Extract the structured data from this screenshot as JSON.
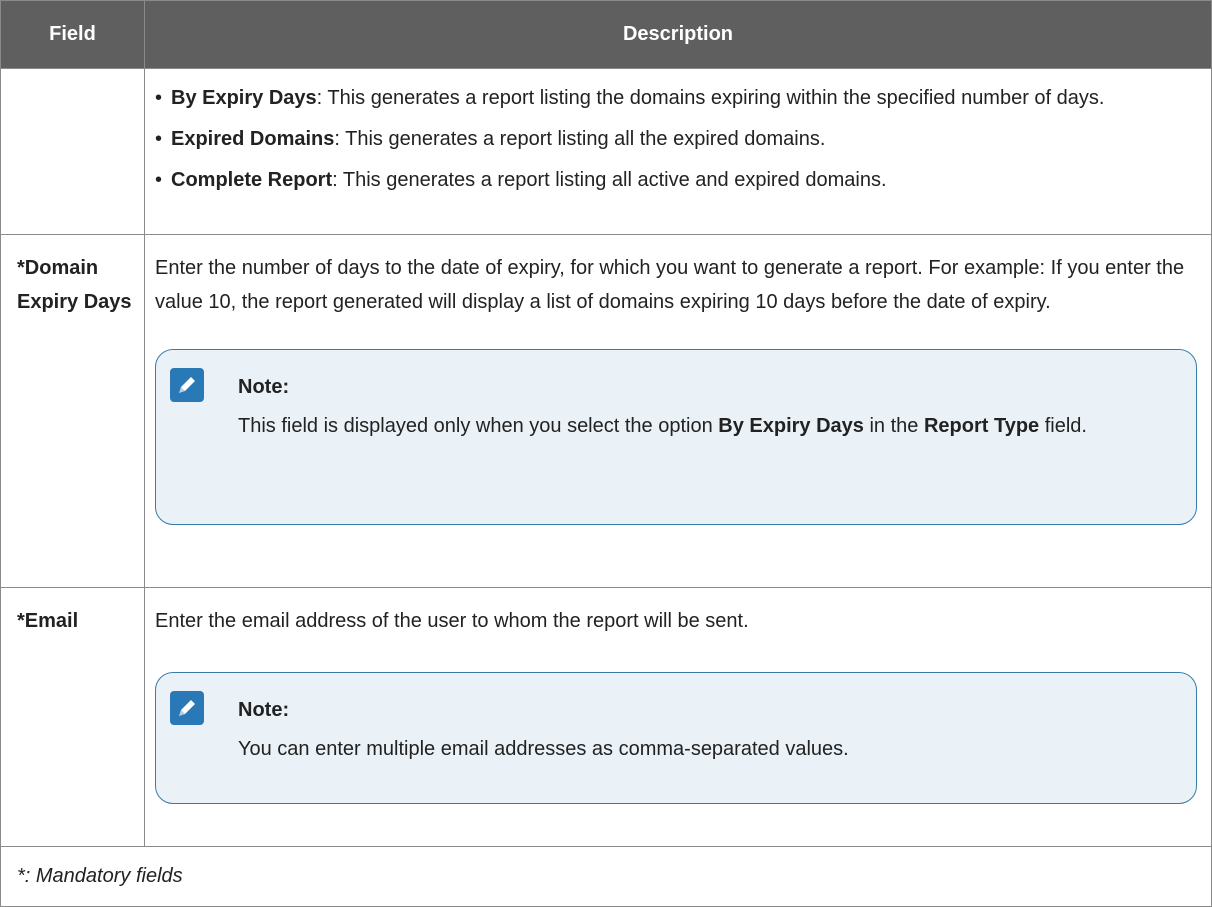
{
  "header": {
    "field": "Field",
    "description": "Description"
  },
  "rows": [
    {
      "field": "",
      "bullets": [
        {
          "marker": "•",
          "term": "By Expiry Days",
          "text": ": This generates a report listing the domains expiring within the specified number of days."
        },
        {
          "marker": "•",
          "term": "Expired Domains",
          "text": ": This generates a report listing all the expired domains."
        },
        {
          "marker": "•",
          "term": "Complete Report",
          "text": ": This generates a report listing all active and expired domains."
        }
      ]
    },
    {
      "field": "*Domain Expiry Days",
      "description": "Enter the number of days to the date of expiry, for which you want to generate a report. For example: If you enter the value 10, the report generated will display a list of domains expiring 10 days before the date of expiry.",
      "note": {
        "title": "Note:",
        "text_1": "This field is displayed only when you select the option ",
        "bold_1": "By Expiry Days",
        "text_2": " in the ",
        "bold_2": "Report Type",
        "text_3": " field."
      }
    },
    {
      "field": "*Email",
      "description": "Enter the email address of the user to whom the report will be sent.",
      "note": {
        "title": "Note:",
        "text": "You can enter multiple email addresses as comma-separated values."
      }
    }
  ],
  "footnote": "*: Mandatory fields",
  "colors": {
    "header_bg": "#5f5f5f",
    "note_border": "#3a7ba6",
    "note_bg": "#eaf2f8",
    "note_icon": "#2a79b7"
  },
  "icons": {
    "note": "note-pencil-icon"
  }
}
